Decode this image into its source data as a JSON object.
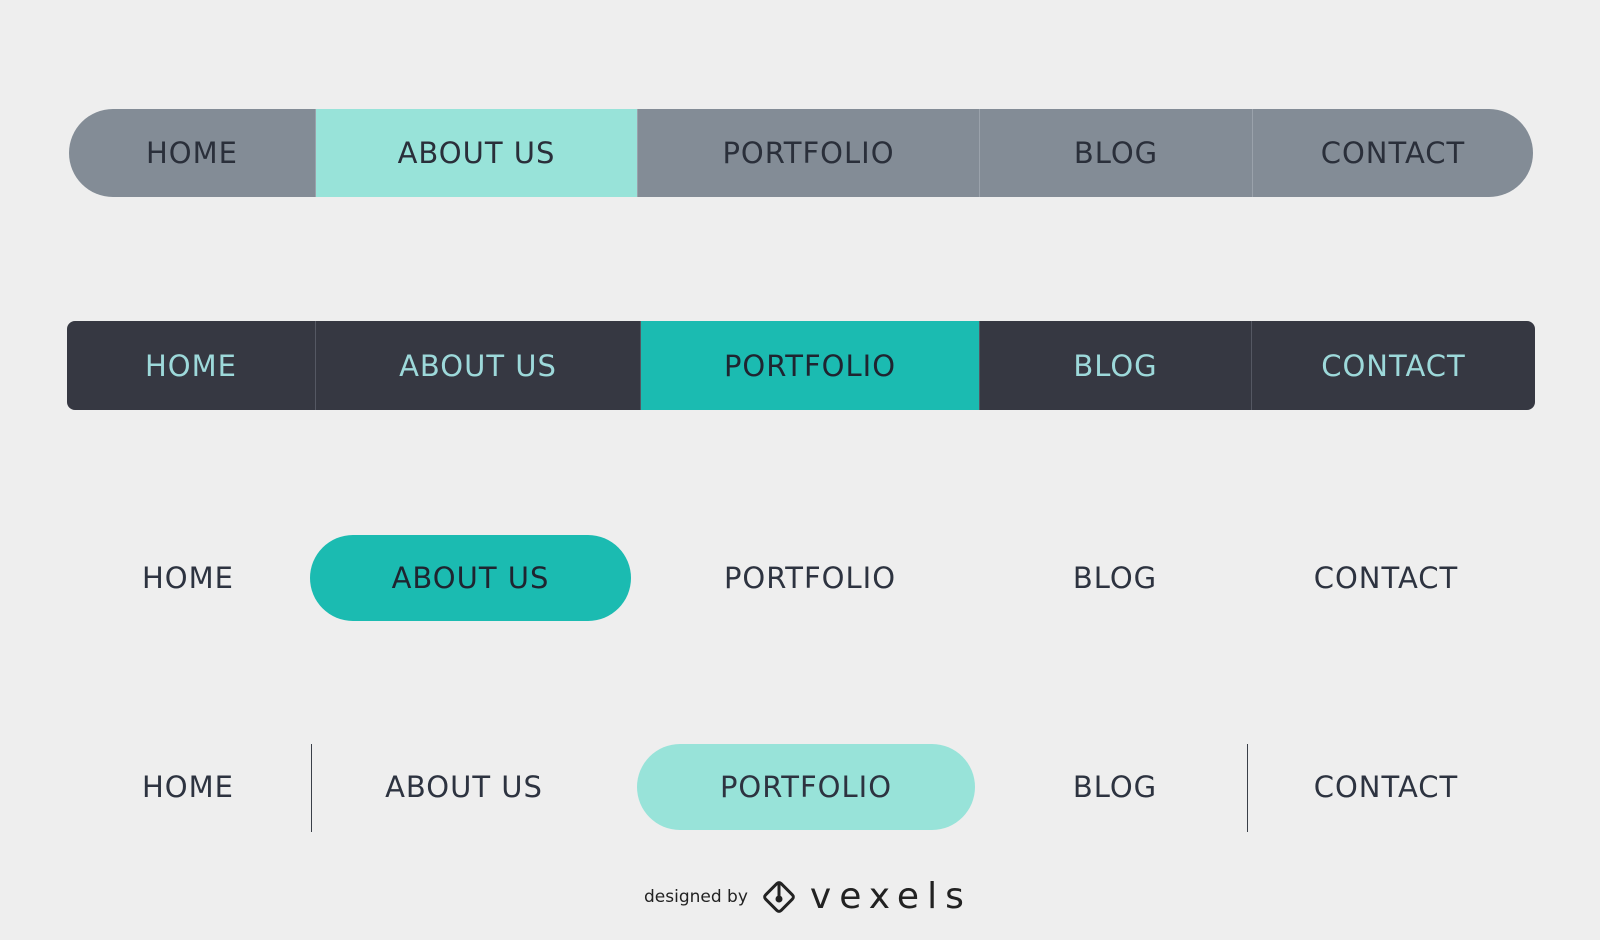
{
  "menus": [
    {
      "items": [
        "HOME",
        "ABOUT US",
        "PORTFOLIO",
        "BLOG",
        "CONTACT"
      ],
      "active": "ABOUT US"
    },
    {
      "items": [
        "HOME",
        "ABOUT US",
        "PORTFOLIO",
        "BLOG",
        "CONTACT"
      ],
      "active": "PORTFOLIO"
    },
    {
      "items": [
        "HOME",
        "ABOUT US",
        "PORTFOLIO",
        "BLOG",
        "CONTACT"
      ],
      "active": "ABOUT US"
    },
    {
      "items": [
        "HOME",
        "ABOUT US",
        "PORTFOLIO",
        "BLOG",
        "CONTACT"
      ],
      "active": "PORTFOLIO"
    }
  ],
  "colors": {
    "background": "#eeeeee",
    "gray_bar": "#838c96",
    "mint": "#98e3d9",
    "dark_bar": "#363842",
    "teal": "#1bbbb1",
    "dark_text": "#2d3340",
    "light_text": "#9dd9da"
  },
  "credit": {
    "designed_by": "designed by",
    "logo": "vexels",
    "logo_icon": "vexels-diamond-logo-icon"
  }
}
